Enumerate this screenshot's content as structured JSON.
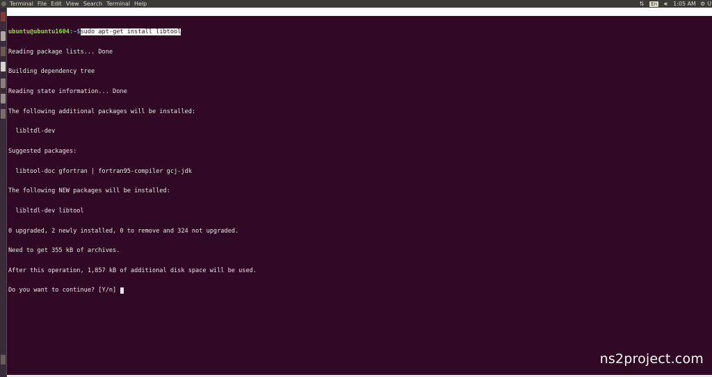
{
  "menubar": {
    "app_name": "Terminal",
    "menus": [
      "File",
      "Edit",
      "View",
      "Search",
      "Terminal",
      "Help"
    ],
    "indicators": {
      "keyboard_layout": "En",
      "clock": "1:05 AM",
      "session_label": "U"
    }
  },
  "terminal": {
    "prompt_user_host": "ubuntu@ubuntu1604",
    "prompt_path": ":~$",
    "command": "sudo apt-get install libtool",
    "output": [
      "Reading package lists... Done",
      "Building dependency tree",
      "Reading state information... Done",
      "The following additional packages will be installed:",
      "  libltdl-dev",
      "Suggested packages:",
      "  libtool-doc gfortran | fortran95-compiler gcj-jdk",
      "The following NEW packages will be installed:",
      "  libltdl-dev libtool",
      "0 upgraded, 2 newly installed, 0 to remove and 324 not upgraded.",
      "Need to get 355 kB of archives.",
      "After this operation, 1,857 kB of additional disk space will be used."
    ],
    "final_prompt": "Do you want to continue? [Y/n] "
  },
  "watermark": "ns2project.com",
  "colors": {
    "terminal_bg": "#300a24",
    "text": "#e8e8e8",
    "prompt_user": "#8ae234",
    "prompt_path": "#729fcf",
    "menubar_bg": "#3c3b37"
  }
}
